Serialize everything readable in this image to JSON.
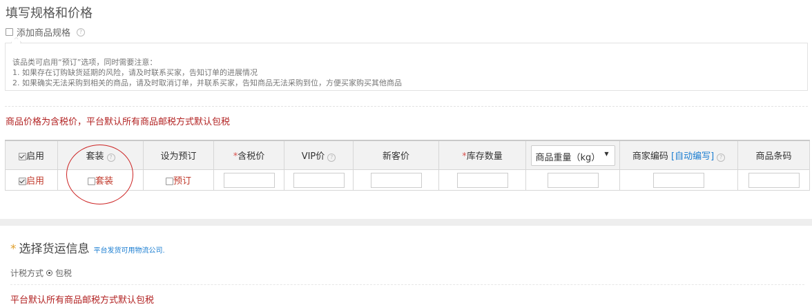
{
  "section_title": "填写规格和价格",
  "add_spec_label": "添加商品规格",
  "help_glyph": "?",
  "notice": {
    "line1": "该品类可启用“预订”选项，同时需要注意：",
    "line2": "1. 如果存在订购缺货延期的风险，请及时联系买家，告知订单的进展情况",
    "line3": "2. 如果确实无法采购到相关的商品，请及时取消订单，并联系买家，告知商品无法采购到位，方便买家购买其他商品"
  },
  "price_note": "商品价格为含税价，平台默认所有商品邮税方式默认包税",
  "table": {
    "headers": {
      "enable": "启用",
      "bundle": "套装",
      "preorder": "设为预订",
      "tax_price_star": "*",
      "tax_price": "含税价",
      "vip_price": "VIP价",
      "new_price": "新客价",
      "stock_star": "*",
      "stock": "库存数量",
      "weight_select": "商品重量（kg）",
      "weight_caret": "▼",
      "merchant_code": "商家编码",
      "auto_code": "[自动编写]",
      "barcode": "商品条码"
    },
    "row": {
      "enable": "启用",
      "bundle": "套装",
      "preorder": "预订"
    }
  },
  "shipping": {
    "star": "*",
    "title": "选择货运信息",
    "link": "平台发货可用物流公司."
  },
  "tax_mode": {
    "label": "计税方式",
    "option": "包税"
  },
  "bottom_note": "平台默认所有商品邮税方式默认包税"
}
